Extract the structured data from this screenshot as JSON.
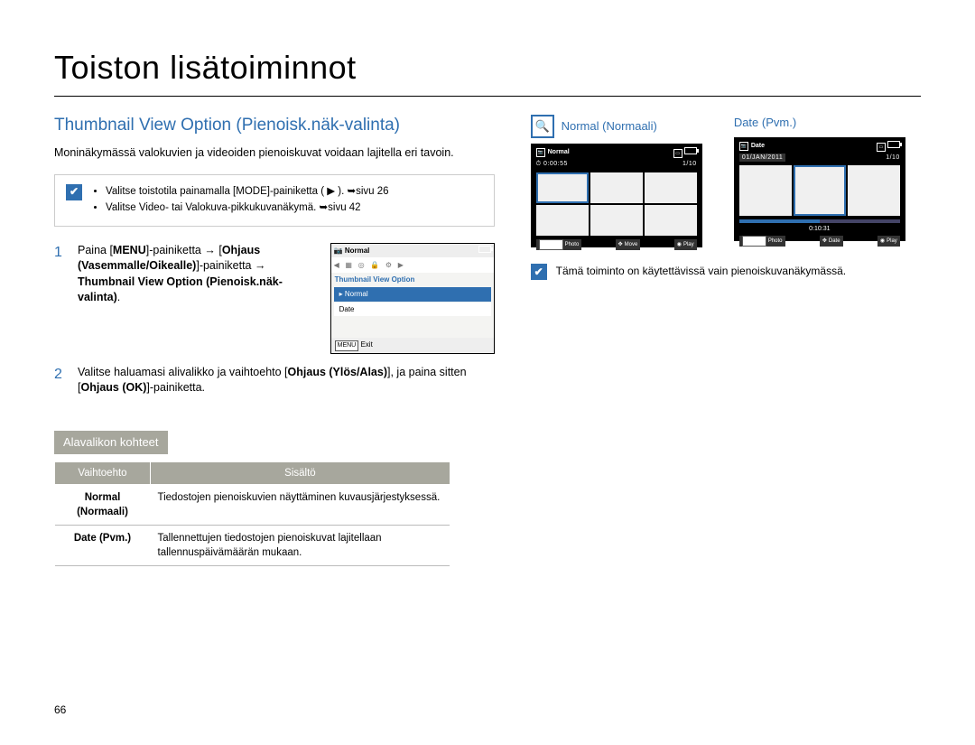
{
  "section_title": "Toiston lisätoiminnot",
  "subsection_title": "Thumbnail View Option (Pienoisk.näk-valinta)",
  "intro": "Moninäkymässä valokuvien ja videoiden pienoiskuvat voidaan lajitella eri tavoin.",
  "general_note": {
    "items": [
      "Valitse toistotila painamalla [MODE]-painiketta ( ▶ ). ➥sivu 26",
      "Valitse Video- tai Valokuva-pikkukuvanäkymä. ➥sivu 42"
    ]
  },
  "steps": [
    {
      "num": "1",
      "html": "Paina [<strong>MENU</strong>]-painiketta → [<strong>Ohjaus (Vasemmalle/Oikealle)</strong>]-painiketta → <strong>Thumbnail View Option (Pienoisk.näk-valinta)</strong>."
    },
    {
      "num": "2",
      "html": "Valitse haluamasi alivalikko ja vaihtoehto [<strong>Ohjaus (Ylös/Alas)</strong>], ja paina sitten [<strong>Ohjaus (OK)</strong>]-painiketta."
    }
  ],
  "menu_figure": {
    "top_icon": "📷",
    "top_label": "Normal",
    "title": "Thumbnail View Option",
    "items": [
      "Normal",
      "Date"
    ],
    "footer_key": "MENU",
    "footer_label": "Exit"
  },
  "subhead": "Alavalikon kohteet",
  "table": {
    "headers": [
      "Vaihtoehto",
      "Sisältö"
    ],
    "rows": [
      {
        "opt": "Normal\n(Normaali)",
        "desc": "Tiedostojen pienoiskuvien näyttäminen kuvausjärjestyksessä."
      },
      {
        "opt": "Date (Pvm.)",
        "desc": "Tallennettujen tiedostojen pienoiskuvat lajitellaan tallennuspäivämäärän mukaan."
      }
    ]
  },
  "right": {
    "mode_a": "Normal (Normaali)",
    "mode_b": "Date (Pvm.)",
    "screen_a": {
      "label": "Normal",
      "time": "0:00:55",
      "count": "1/10",
      "footer": [
        {
          "key": "ZOOM",
          "label": "Photo"
        },
        {
          "key": "",
          "label": "Move"
        },
        {
          "key": "",
          "label": "Play"
        }
      ]
    },
    "screen_b": {
      "label": "Date",
      "date_banner": "01/JAN/2011",
      "count": "1/10",
      "time": "0:10:31",
      "footer": [
        {
          "key": "ZOOM",
          "label": "Photo"
        },
        {
          "key": "",
          "label": "Date"
        },
        {
          "key": "",
          "label": "Play"
        }
      ]
    },
    "tip": "Tämä toiminto on käytettävissä vain pienoiskuvanäkymässä."
  },
  "page_num": "66"
}
